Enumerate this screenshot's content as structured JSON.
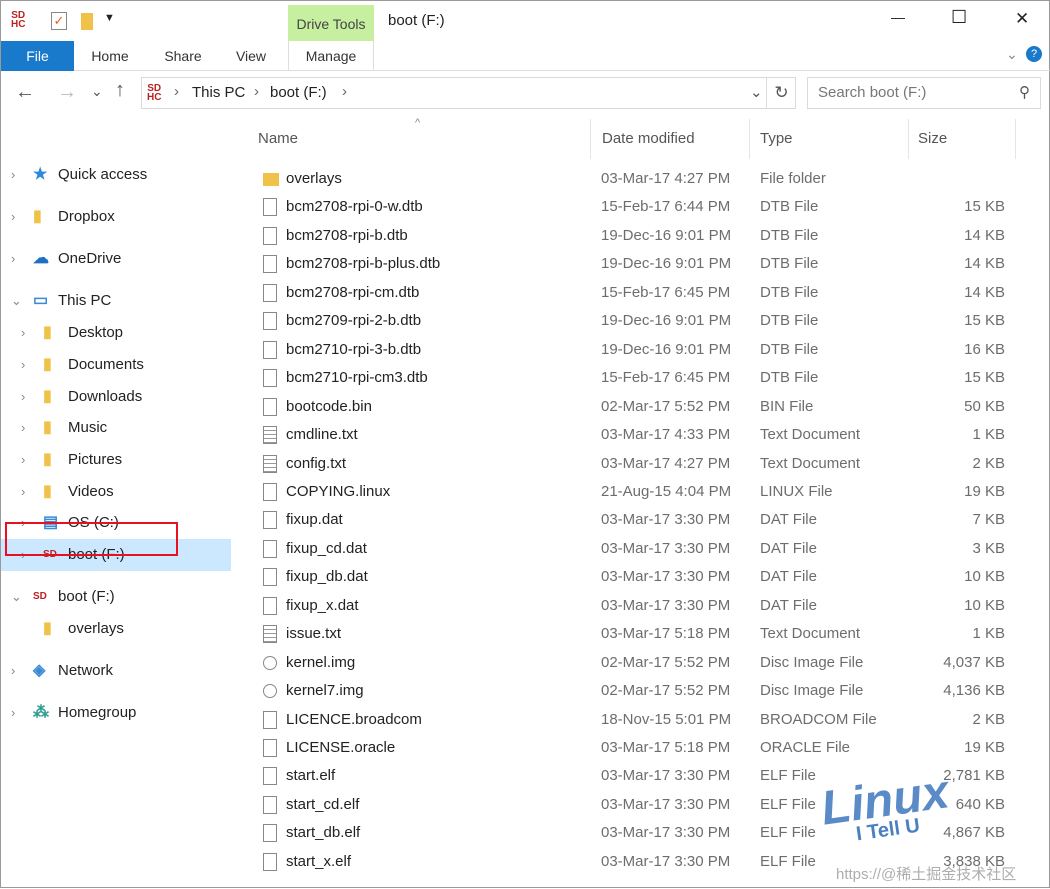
{
  "window": {
    "title": "boot (F:)",
    "context_tab": "Drive Tools",
    "minimize": "—",
    "maximize": "☐",
    "close": "✕"
  },
  "ribbon": {
    "tabs": [
      "File",
      "Home",
      "Share",
      "View",
      "Manage"
    ]
  },
  "address": {
    "crumbs": [
      "This PC",
      "boot (F:)"
    ],
    "search_placeholder": "Search boot (F:)"
  },
  "nav": [
    {
      "label": "Quick access",
      "icon": "star-icon",
      "indent": 0,
      "chev": "›"
    },
    {
      "label": "Dropbox",
      "icon": "dropbox-icon",
      "indent": 0,
      "chev": "›"
    },
    {
      "label": "OneDrive",
      "icon": "cloud-icon",
      "indent": 0,
      "chev": "›"
    },
    {
      "label": "This PC",
      "icon": "pc-icon",
      "indent": 0,
      "chev": "⌄"
    },
    {
      "label": "Desktop",
      "icon": "folder-icon",
      "indent": 1,
      "chev": "›"
    },
    {
      "label": "Documents",
      "icon": "folder-icon",
      "indent": 1,
      "chev": "›"
    },
    {
      "label": "Downloads",
      "icon": "folder-icon",
      "indent": 1,
      "chev": "›"
    },
    {
      "label": "Music",
      "icon": "folder-icon",
      "indent": 1,
      "chev": "›"
    },
    {
      "label": "Pictures",
      "icon": "folder-icon",
      "indent": 1,
      "chev": "›"
    },
    {
      "label": "Videos",
      "icon": "folder-icon",
      "indent": 1,
      "chev": "›"
    },
    {
      "label": "OS (C:)",
      "icon": "drive-icon",
      "indent": 1,
      "chev": "›"
    },
    {
      "label": "boot (F:)",
      "icon": "sd-icon",
      "indent": 1,
      "chev": "›",
      "selected": true
    },
    {
      "label": "boot (F:)",
      "icon": "sd-icon",
      "indent": 0,
      "chev": "⌄"
    },
    {
      "label": "overlays",
      "icon": "folder-icon",
      "indent": 1,
      "chev": ""
    },
    {
      "label": "Network",
      "icon": "network-icon",
      "indent": 0,
      "chev": "›"
    },
    {
      "label": "Homegroup",
      "icon": "homegroup-icon",
      "indent": 0,
      "chev": "›"
    }
  ],
  "columns": [
    "Name",
    "Date modified",
    "Type",
    "Size"
  ],
  "files": [
    [
      "overlays",
      "03-Mar-17 4:27 PM",
      "File folder",
      ""
    ],
    [
      "bcm2708-rpi-0-w.dtb",
      "15-Feb-17 6:44 PM",
      "DTB File",
      "15 KB"
    ],
    [
      "bcm2708-rpi-b.dtb",
      "19-Dec-16 9:01 PM",
      "DTB File",
      "14 KB"
    ],
    [
      "bcm2708-rpi-b-plus.dtb",
      "19-Dec-16 9:01 PM",
      "DTB File",
      "14 KB"
    ],
    [
      "bcm2708-rpi-cm.dtb",
      "15-Feb-17 6:45 PM",
      "DTB File",
      "14 KB"
    ],
    [
      "bcm2709-rpi-2-b.dtb",
      "19-Dec-16 9:01 PM",
      "DTB File",
      "15 KB"
    ],
    [
      "bcm2710-rpi-3-b.dtb",
      "19-Dec-16 9:01 PM",
      "DTB File",
      "16 KB"
    ],
    [
      "bcm2710-rpi-cm3.dtb",
      "15-Feb-17 6:45 PM",
      "DTB File",
      "15 KB"
    ],
    [
      "bootcode.bin",
      "02-Mar-17 5:52 PM",
      "BIN File",
      "50 KB"
    ],
    [
      "cmdline.txt",
      "03-Mar-17 4:33 PM",
      "Text Document",
      "1 KB"
    ],
    [
      "config.txt",
      "03-Mar-17 4:27 PM",
      "Text Document",
      "2 KB"
    ],
    [
      "COPYING.linux",
      "21-Aug-15 4:04 PM",
      "LINUX File",
      "19 KB"
    ],
    [
      "fixup.dat",
      "03-Mar-17 3:30 PM",
      "DAT File",
      "7 KB"
    ],
    [
      "fixup_cd.dat",
      "03-Mar-17 3:30 PM",
      "DAT File",
      "3 KB"
    ],
    [
      "fixup_db.dat",
      "03-Mar-17 3:30 PM",
      "DAT File",
      "10 KB"
    ],
    [
      "fixup_x.dat",
      "03-Mar-17 3:30 PM",
      "DAT File",
      "10 KB"
    ],
    [
      "issue.txt",
      "03-Mar-17 5:18 PM",
      "Text Document",
      "1 KB"
    ],
    [
      "kernel.img",
      "02-Mar-17 5:52 PM",
      "Disc Image File",
      "4,037 KB"
    ],
    [
      "kernel7.img",
      "02-Mar-17 5:52 PM",
      "Disc Image File",
      "4,136 KB"
    ],
    [
      "LICENCE.broadcom",
      "18-Nov-15 5:01 PM",
      "BROADCOM File",
      "2 KB"
    ],
    [
      "LICENSE.oracle",
      "03-Mar-17 5:18 PM",
      "ORACLE File",
      "19 KB"
    ],
    [
      "start.elf",
      "03-Mar-17 3:30 PM",
      "ELF File",
      "2,781 KB"
    ],
    [
      "start_cd.elf",
      "03-Mar-17 3:30 PM",
      "ELF File",
      "640 KB"
    ],
    [
      "start_db.elf",
      "03-Mar-17 3:30 PM",
      "ELF File",
      "4,867 KB"
    ],
    [
      "start_x.elf",
      "03-Mar-17 3:30 PM",
      "ELF File",
      "3,838 KB"
    ]
  ],
  "watermark": {
    "logo": "Linux",
    "sub": "I Tell U",
    "credit": "https://@稀土掘金技术社区"
  },
  "colors": {
    "file_tab": "#1979ca",
    "drive_tools": "#c6efa0",
    "selected": "#cce8ff",
    "highlight": "#e81123"
  }
}
